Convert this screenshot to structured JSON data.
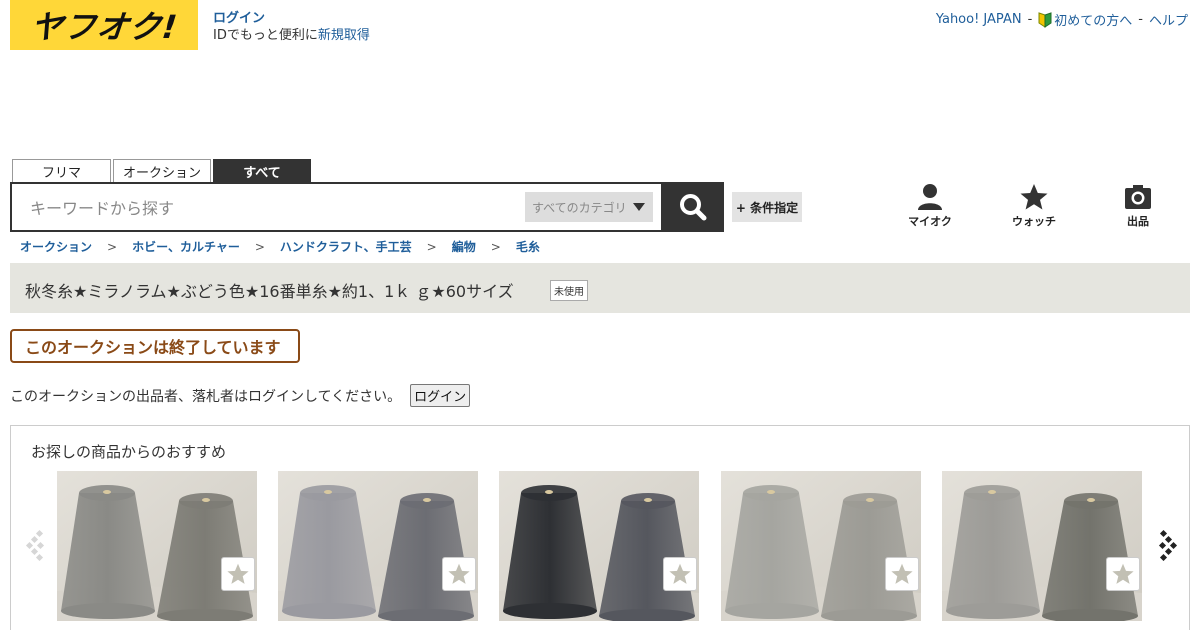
{
  "header": {
    "logo_text": "ヤフオク!",
    "login_link": "ログイン",
    "id_text": "IDでもっと便利に",
    "signup_link": "新規取得",
    "top_links": {
      "yahoo": "Yahoo! JAPAN",
      "beginner": "初めての方へ",
      "help": "ヘルプ",
      "separator": "-"
    }
  },
  "search": {
    "tabs": [
      {
        "label": "フリマ",
        "active": false
      },
      {
        "label": "オークション",
        "active": false
      },
      {
        "label": "すべて",
        "active": true
      }
    ],
    "placeholder": "キーワードから探す",
    "category_select": "すべてのカテゴリ",
    "search_button_icon": "search-icon",
    "conditions_button": "+ 条件指定"
  },
  "nav_icons": [
    {
      "label": "マイオク",
      "icon": "user-icon"
    },
    {
      "label": "ウォッチ",
      "icon": "star-icon"
    },
    {
      "label": "出品",
      "icon": "camera-icon"
    }
  ],
  "breadcrumb": {
    "items": [
      "オークション",
      "ホビー、カルチャー",
      "ハンドクラフト、手工芸",
      "編物",
      "毛糸"
    ],
    "separator": ">"
  },
  "item": {
    "title": "秋冬糸★ミラノラム★ぶどう色★16番単糸★約1、1ｋ ｇ★60サイズ",
    "condition_badge": "未使用"
  },
  "status": {
    "ended_label": "このオークションは終了しています",
    "login_notice": "このオークションの出品者、落札者はログインしてください。",
    "login_button": "ログイン"
  },
  "recommendations": {
    "heading": "お探しの商品からのおすすめ",
    "items": [
      {
        "watch_icon": "star-icon",
        "colors": [
          "#8a8a86",
          "#7d7c75"
        ]
      },
      {
        "watch_icon": "star-icon",
        "colors": [
          "#9a9aa0",
          "#6c6d73"
        ]
      },
      {
        "watch_icon": "star-icon",
        "colors": [
          "#2e3034",
          "#55575e"
        ]
      },
      {
        "watch_icon": "star-icon",
        "colors": [
          "#a5a5a0",
          "#9c9b95"
        ]
      },
      {
        "watch_icon": "star-icon",
        "colors": [
          "#9d9c98",
          "#73736c"
        ]
      }
    ]
  },
  "colors": {
    "brand_yellow": "#ffd738",
    "link_blue": "#1f5e9a",
    "ended_brown": "#8a4a17",
    "dark": "#333333"
  }
}
